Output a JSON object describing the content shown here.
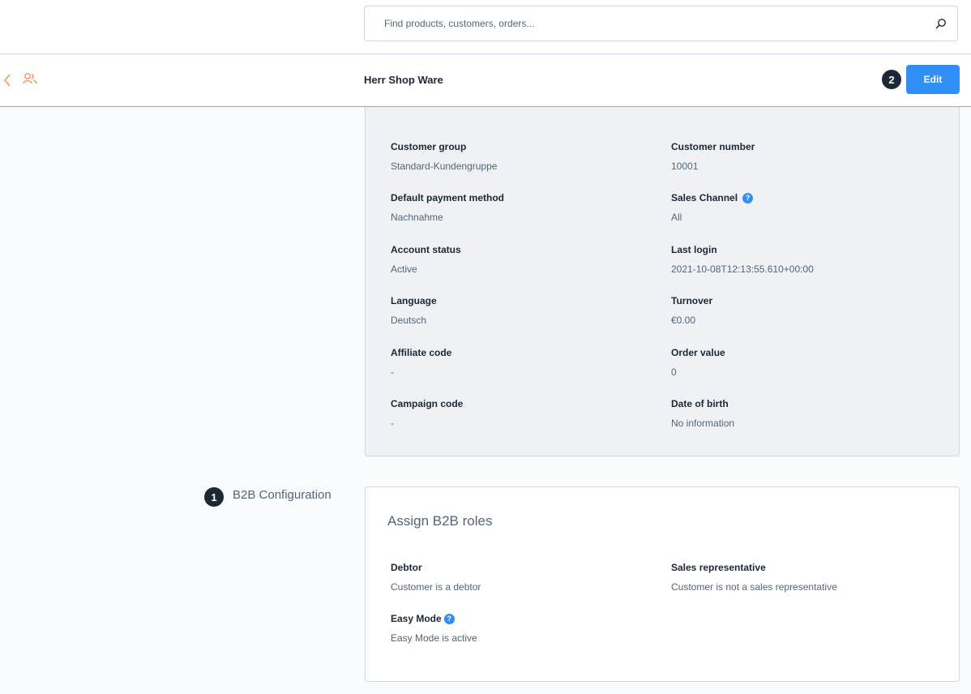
{
  "search": {
    "placeholder": "Find products, customers, orders...",
    "icon": "search-icon"
  },
  "header": {
    "title": "Herr Shop Ware",
    "edit_label": "Edit",
    "callout": "2"
  },
  "details": [
    {
      "label": "Customer group",
      "value": "Standard-Kundengruppe"
    },
    {
      "label": "Customer number",
      "value": "10001"
    },
    {
      "label": "Default payment method",
      "value": "Nachnahme"
    },
    {
      "label": "Sales Channel",
      "value": "All"
    },
    {
      "label": "Account status",
      "value": "Active"
    },
    {
      "label": "Last login",
      "value": "2021-10-08T12:13:55.610+00:00"
    },
    {
      "label": "Language",
      "value": "Deutsch"
    },
    {
      "label": "Turnover",
      "value": "€0.00"
    },
    {
      "label": "Affiliate code",
      "value": "-"
    },
    {
      "label": "Order value",
      "value": "0"
    },
    {
      "label": "Campaign code",
      "value": "-"
    },
    {
      "label": "Date of birth",
      "value": "No information"
    }
  ],
  "b2b": {
    "section_label": "B2B Configuration",
    "callout": "1",
    "card_title": "Assign B2B roles",
    "fields": [
      {
        "label": "Debtor",
        "value": "Customer is a debtor"
      },
      {
        "label": "Sales representative",
        "value": "Customer is not a sales representative"
      },
      {
        "label": "Easy Mode",
        "value": "Easy Mode is active"
      }
    ]
  },
  "colors": {
    "accent": "#2f8ff7",
    "brand_orange": "#f58c54",
    "text_dark": "#1b2936",
    "text": "#52667a"
  }
}
